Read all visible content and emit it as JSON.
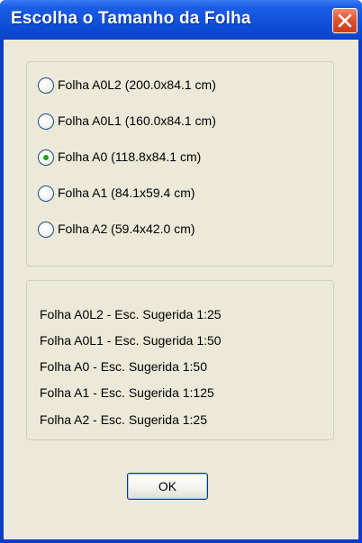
{
  "window": {
    "title": "Escolha o Tamanho da Folha"
  },
  "sheet_options": [
    {
      "label": "Folha A0L2 (200.0x84.1 cm)",
      "selected": false
    },
    {
      "label": "Folha A0L1 (160.0x84.1 cm)",
      "selected": false
    },
    {
      "label": "Folha A0 (118.8x84.1 cm)",
      "selected": true
    },
    {
      "label": "Folha A1 (84.1x59.4 cm)",
      "selected": false
    },
    {
      "label": "Folha A2 (59.4x42.0 cm)",
      "selected": false
    }
  ],
  "suggested_scales": [
    "Folha A0L2 - Esc. Sugerida 1:25",
    "Folha A0L1 - Esc. Sugerida 1:50",
    "Folha A0 - Esc. Sugerida 1:50",
    "Folha A1 - Esc. Sugerida 1:125",
    "Folha A2 - Esc. Sugerida 1:25"
  ],
  "buttons": {
    "ok_label": "OK"
  },
  "icons": {
    "close": "close-icon"
  },
  "colors": {
    "titlebar": "#0f4fd9",
    "client_background": "#ece9d8",
    "close_button": "#e0512f",
    "radio_selected": "#21a121"
  }
}
